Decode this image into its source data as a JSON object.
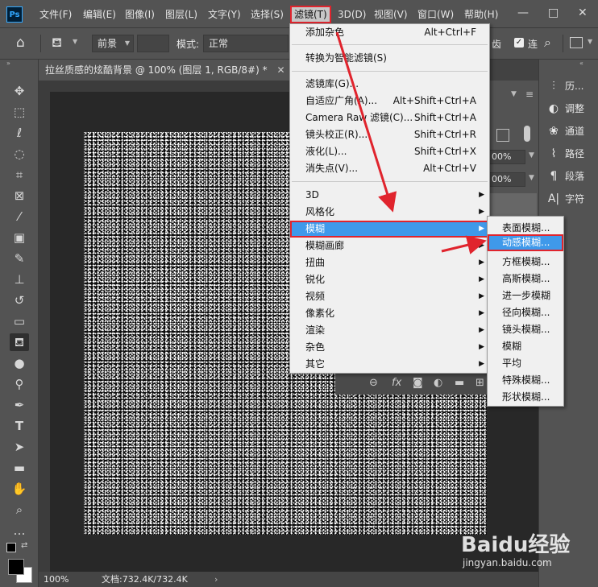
{
  "app": {
    "logo_text": "Ps"
  },
  "menubar": {
    "items": [
      "文件(F)",
      "编辑(E)",
      "图像(I)",
      "图层(L)",
      "文字(Y)",
      "选择(S)",
      "滤镜(T)",
      "3D(D)",
      "视图(V)",
      "窗口(W)",
      "帮助(H)"
    ],
    "active": "滤镜(T)",
    "window_controls": [
      "—",
      "□",
      "✕"
    ]
  },
  "options": {
    "home_icon": "home-icon",
    "bucket_icon": "paint-bucket-icon",
    "fill_source": "前景",
    "mode_label": "模式:",
    "mode_value": "正常",
    "right_partial": "齿",
    "contiguous_label": "连",
    "search_icon": "search-icon"
  },
  "document": {
    "tab_title": "拉丝质感的炫酷背景 @ 100% (图层 1, RGB/8#) *",
    "close_icon": "close-icon"
  },
  "status": {
    "zoom": "100%",
    "docinfo": "文档:732.4K/732.4K",
    "arrow": "›"
  },
  "layers_panel": {
    "opacity_partial": "00%",
    "fill_partial": "00%"
  },
  "right_dock": [
    {
      "label": "历...",
      "icon": "history-icon"
    },
    {
      "label": "调整",
      "icon": "adjustments-icon"
    },
    {
      "label": "通道",
      "icon": "channels-icon"
    },
    {
      "label": "路径",
      "icon": "paths-icon"
    },
    {
      "label": "段落",
      "icon": "paragraph-icon"
    },
    {
      "label": "字符",
      "icon": "character-icon"
    }
  ],
  "filter_menu": {
    "group1": [
      {
        "label": "添加杂色",
        "shortcut": "Alt+Ctrl+F"
      }
    ],
    "group2": [
      {
        "label": "转换为智能滤镜(S)",
        "shortcut": ""
      }
    ],
    "group3": [
      {
        "label": "滤镜库(G)...",
        "shortcut": ""
      },
      {
        "label": "自适应广角(A)...",
        "shortcut": "Alt+Shift+Ctrl+A"
      },
      {
        "label": "Camera Raw 滤镜(C)...",
        "shortcut": "Shift+Ctrl+A"
      },
      {
        "label": "镜头校正(R)...",
        "shortcut": "Shift+Ctrl+R"
      },
      {
        "label": "液化(L)...",
        "shortcut": "Shift+Ctrl+X"
      },
      {
        "label": "消失点(V)...",
        "shortcut": "Alt+Ctrl+V"
      }
    ],
    "group4": [
      "3D",
      "风格化",
      "模糊",
      "模糊画廊",
      "扭曲",
      "锐化",
      "视频",
      "像素化",
      "渲染",
      "杂色",
      "其它"
    ],
    "highlighted": "模糊"
  },
  "blur_submenu": {
    "items": [
      "表面模糊...",
      "动感模糊...",
      "方框模糊...",
      "高斯模糊...",
      "进一步模糊",
      "径向模糊...",
      "镜头模糊...",
      "模糊",
      "平均",
      "特殊模糊...",
      "形状模糊..."
    ],
    "highlighted": "动感模糊..."
  },
  "watermark": {
    "logo": "Baidu经验",
    "url": "jingyan.baidu.com"
  },
  "colors": {
    "ui_gray": "#535353",
    "highlight_blue": "#3f99ea",
    "annotation_red": "#e0242d",
    "menu_bg": "#f0f0f0"
  }
}
